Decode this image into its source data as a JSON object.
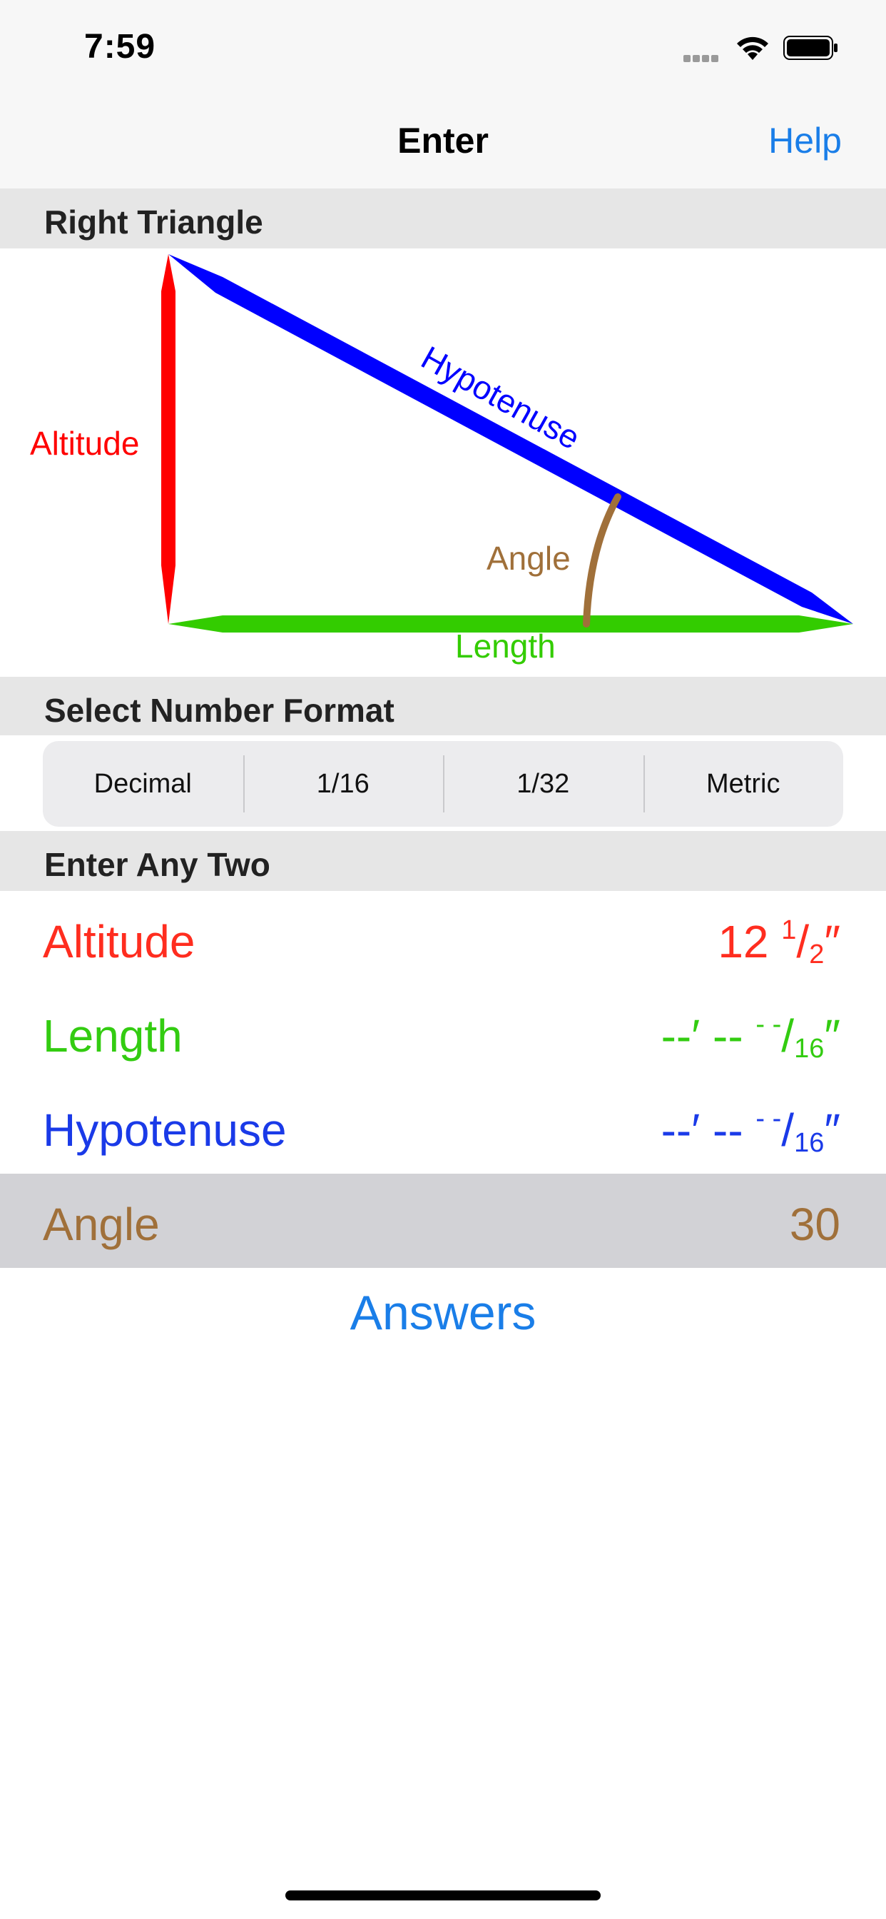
{
  "status_bar": {
    "time": "7:59"
  },
  "nav": {
    "title": "Enter",
    "help_label": "Help"
  },
  "sections": {
    "triangle": "Right Triangle",
    "format": "Select Number Format",
    "enter": "Enter Any Two"
  },
  "diagram": {
    "altitude_label": "Altitude",
    "hypotenuse_label": "Hypotenuse",
    "angle_label": "Angle",
    "length_label": "Length",
    "colors": {
      "altitude": "#ff0000",
      "hypotenuse": "#0000ff",
      "length": "#33cc00",
      "angle": "#a0703a"
    }
  },
  "number_format": {
    "options": [
      "Decimal",
      "1/16",
      "1/32",
      "Metric"
    ]
  },
  "fields": [
    {
      "label": "Altitude",
      "value_whole": "12 ",
      "value_num": "1",
      "value_den": "2",
      "value_unit": "″",
      "color": "#ff2d1f"
    },
    {
      "label": "Length",
      "value_ft": "--′ -- ",
      "value_num": "- -",
      "value_den": "16",
      "value_unit": "″",
      "color": "#33cc11"
    },
    {
      "label": "Hypotenuse",
      "value_ft": "--′ -- ",
      "value_num": "- -",
      "value_den": "16",
      "value_unit": "″",
      "color": "#1a3ae8"
    },
    {
      "label": "Angle",
      "value": "30",
      "color": "#a0703a",
      "selected": true
    }
  ],
  "answers_label": "Answers"
}
